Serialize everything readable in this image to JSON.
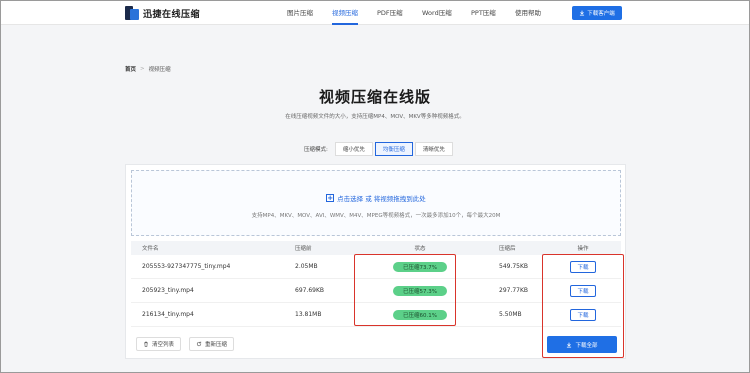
{
  "header": {
    "logo_text": "迅捷在线压缩",
    "nav": [
      {
        "label": "图片压缩",
        "active": false
      },
      {
        "label": "视频压缩",
        "active": true
      },
      {
        "label": "PDF压缩",
        "active": false
      },
      {
        "label": "Word压缩",
        "active": false
      },
      {
        "label": "PPT压缩",
        "active": false
      },
      {
        "label": "使用帮助",
        "active": false
      }
    ],
    "download_client_label": "下载客户端"
  },
  "breadcrumb": {
    "home": "首页",
    "current": "视频压缩"
  },
  "page": {
    "title": "视频压缩在线版",
    "subtitle": "在线压缩视频文件的大小，支持压缩MP4、MOV、MKV等多种视频格式。"
  },
  "mode": {
    "label": "压缩模式:",
    "options": [
      "缩小优先",
      "均衡压缩",
      "清晰优先"
    ],
    "selected": "均衡压缩"
  },
  "upload": {
    "action_text": "点击选择 或 将视频拖拽到此处",
    "hint": "支持MP4、MKV、MOV、AVI、WMV、M4V、MPEG等视频格式，一次最多添加10个，每个最大20M"
  },
  "table": {
    "headers": {
      "name": "文件名",
      "before": "压缩前",
      "status": "状态",
      "after": "压缩后",
      "op": "操作"
    },
    "rows": [
      {
        "name": "205553-927347775_tiny.mp4",
        "before": "2.05MB",
        "status": "已压缩73.7%",
        "after": "549.75KB",
        "op": "下载"
      },
      {
        "name": "205923_tiny.mp4",
        "before": "697.69KB",
        "status": "已压缩57.3%",
        "after": "297.77KB",
        "op": "下载"
      },
      {
        "name": "216134_tiny.mp4",
        "before": "13.81MB",
        "status": "已压缩60.1%",
        "after": "5.50MB",
        "op": "下载"
      }
    ]
  },
  "actions": {
    "clear": "清空列表",
    "recompress": "重新压缩",
    "download_all": "下载全部"
  },
  "icons": [
    "logo-icon",
    "download-icon",
    "plus-icon",
    "trash-icon",
    "refresh-icon"
  ],
  "colors": {
    "accent": "#1f6fe5",
    "success": "#5cd089",
    "highlight": "#d9342b"
  }
}
